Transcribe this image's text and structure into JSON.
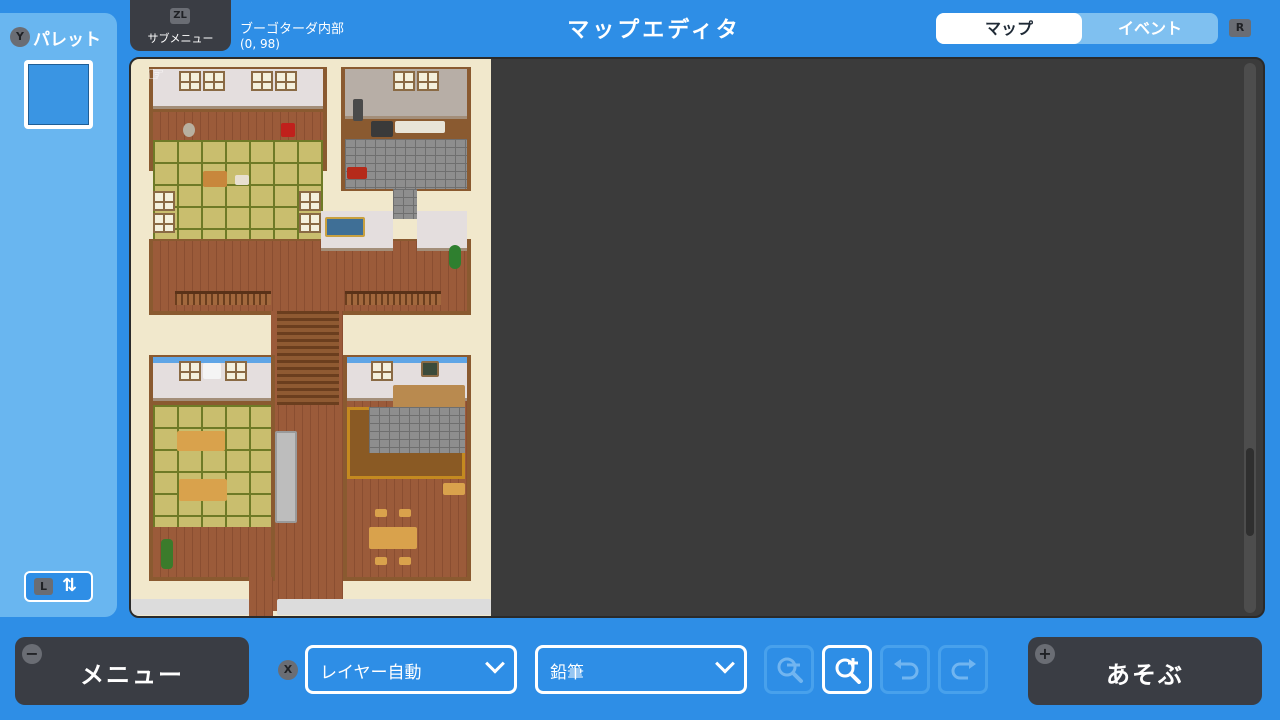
{
  "header": {
    "title": "マップエディタ",
    "submenu": {
      "key": "ZL",
      "label": "サブメニュー"
    },
    "map_name": "ブーゴターダ内部",
    "coordinates": "(0, 98)",
    "tabs": [
      {
        "label": "マップ",
        "active": true
      },
      {
        "label": "イベント",
        "active": false
      }
    ],
    "tab_key": "R"
  },
  "palette": {
    "key": "Y",
    "title": "パレット",
    "toggle_key": "L"
  },
  "toolbar": {
    "menu": {
      "label": "メニュー",
      "badge": "−"
    },
    "layer_key": "X",
    "layer_select": "レイヤー自動",
    "tool_select": "鉛筆",
    "play": {
      "label": "あそぶ",
      "badge": "+"
    }
  },
  "colors": {
    "background": "#2e8ee6",
    "canvas": "#3b3b3b",
    "panel_dark": "#3a3d44",
    "palette_panel": "#69b6f0"
  },
  "icons": {
    "zoom_out": "zoom-out-icon",
    "zoom_in": "zoom-in-icon",
    "undo": "undo-icon",
    "redo": "redo-icon",
    "swap": "swap-arrows-icon"
  }
}
